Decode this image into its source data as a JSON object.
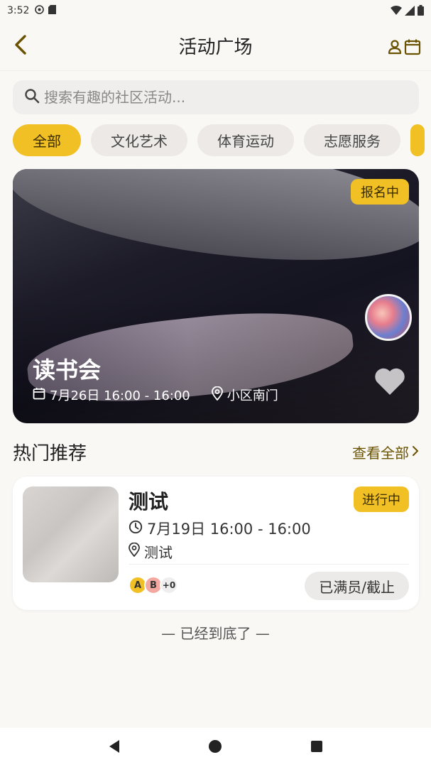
{
  "status_bar": {
    "time": "3:52"
  },
  "header": {
    "title": "活动广场"
  },
  "search": {
    "placeholder": "搜索有趣的社区活动..."
  },
  "categories": [
    {
      "label": "全部",
      "active": true
    },
    {
      "label": "文化艺术",
      "active": false
    },
    {
      "label": "体育运动",
      "active": false
    },
    {
      "label": "志愿服务",
      "active": false
    }
  ],
  "featured": {
    "badge": "报名中",
    "title": "读书会",
    "time": "7月26日 16:00 - 16:00",
    "location": "小区南门"
  },
  "section": {
    "title": "热门推荐",
    "view_all": "查看全部"
  },
  "activities": [
    {
      "title": "测试",
      "badge": "进行中",
      "time": "7月19日 16:00 - 16:00",
      "location": "测试",
      "participants": [
        "A",
        "B"
      ],
      "more_count": "+0",
      "action": "已满员/截止"
    }
  ],
  "footer": {
    "end_text": "— 已经到底了 —"
  },
  "colors": {
    "accent": "#f0c024",
    "accent_text": "#6a5300",
    "background": "#faf8f5"
  }
}
